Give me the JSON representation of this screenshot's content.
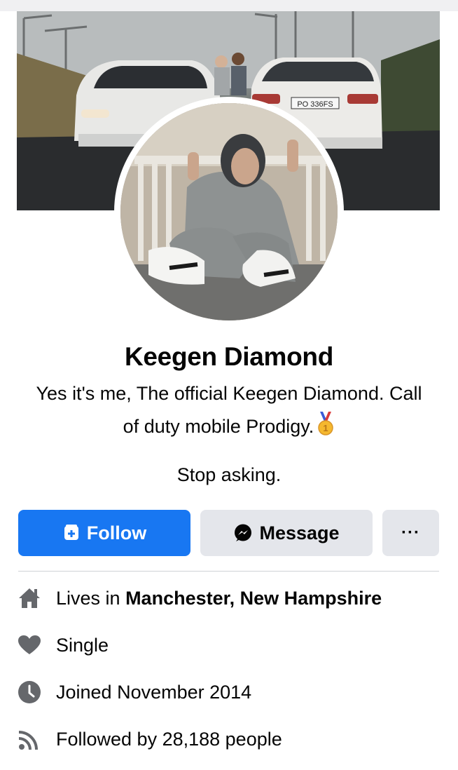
{
  "profile": {
    "name": "Keegen Diamond",
    "bio_line1": "Yes it's me, The official Keegen Diamond. Call",
    "bio_line2": "of duty mobile Prodigy.",
    "bio_line3": "Stop asking.",
    "plate_text": "PO 336FS"
  },
  "actions": {
    "follow_label": "Follow",
    "message_label": "Message",
    "more_label": "···"
  },
  "details": [
    {
      "icon": "home-icon",
      "prefix": "Lives in ",
      "value": "Manchester, New Hampshire"
    },
    {
      "icon": "heart-icon",
      "prefix": "",
      "value": "Single"
    },
    {
      "icon": "clock-icon",
      "prefix": "",
      "value": "Joined November 2014"
    },
    {
      "icon": "rss-icon",
      "prefix": "",
      "value": "Followed by 28,188 people"
    }
  ],
  "colors": {
    "primary": "#1877f2",
    "secondary_button": "#e4e6eb",
    "icon_gray": "#65676b"
  }
}
